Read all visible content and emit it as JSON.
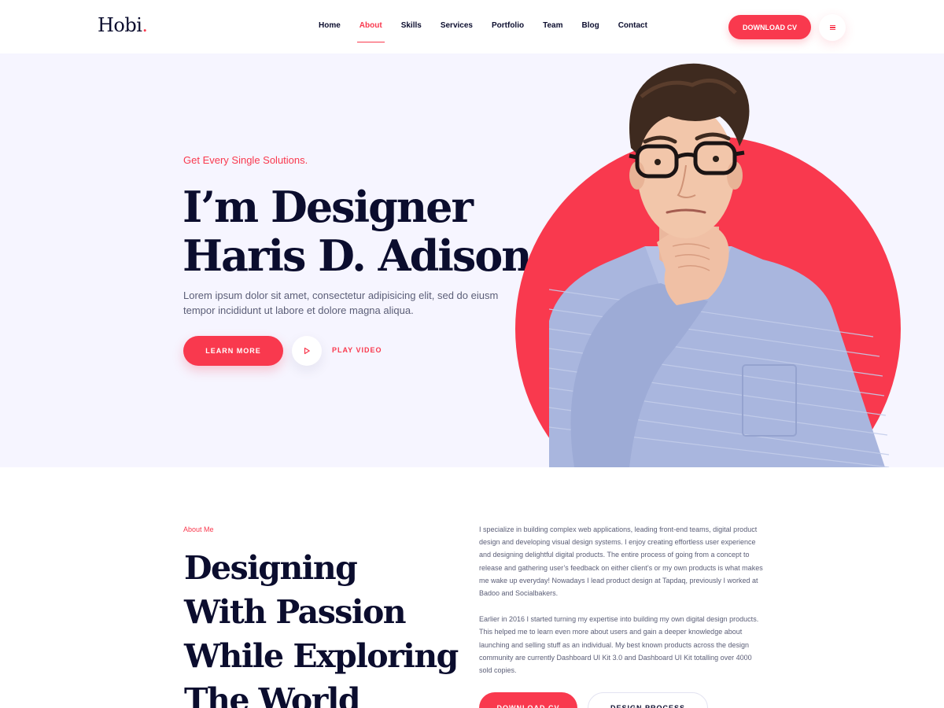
{
  "brand": {
    "name": "Hobi",
    "dot": "."
  },
  "nav": {
    "items": [
      {
        "label": "Home",
        "active": false
      },
      {
        "label": "About",
        "active": true
      },
      {
        "label": "Skills",
        "active": false
      },
      {
        "label": "Services",
        "active": false
      },
      {
        "label": "Portfolio",
        "active": false
      },
      {
        "label": "Team",
        "active": false
      },
      {
        "label": "Blog",
        "active": false
      },
      {
        "label": "Contact",
        "active": false
      }
    ],
    "download_label": "DOWNLOAD CV",
    "menu_icon": "hamburger-menu-icon"
  },
  "hero": {
    "tagline": "Get Every Single Solutions.",
    "title_line1": "I’m Designer",
    "title_line2": "Haris D. Adison",
    "description": "Lorem ipsum dolor sit amet, consectetur adipisicing elit, sed do eiusm tempor incididunt ut labore et dolore magna aliqua.",
    "learn_more_label": "LEARN MORE",
    "play_icon": "play-icon",
    "play_video_label": "PLAY VIDEO",
    "image": "portrait-of-man-with-glasses"
  },
  "about": {
    "label": "About Me",
    "title_line1": "Designing",
    "title_line2": "With Passion",
    "title_line3": "While Exploring",
    "title_line4": "The World",
    "paragraph1": "I specialize in building complex web applications, leading front-end teams, digital product design and developing visual design systems. I enjoy creating effortless user experience and designing delightful digital products. The entire process of going from a concept to release and gathering user’s feedback on either client’s or my own products is what makes me wake up everyday! Nowadays I lead product design at Tapdaq, previously I worked at Badoo and Socialbakers.",
    "paragraph2": "Earlier in 2016 I started turning my expertise into building my own digital design products. This helped me to learn even more about users and gain a deeper knowledge about launching and selling stuff as an individual. My best known products across the design community are currently Dashboard UI Kit 3.0 and Dashboard UI Kit totalling over 4000 sold copies.",
    "download_label": "DOWNLOAD CV",
    "process_label": "DESIGN PROCESS"
  },
  "colors": {
    "accent": "#f9394e",
    "dark": "#0b0d2e",
    "hero_bg": "#f6f5ff",
    "body_text": "#5b5e77"
  }
}
